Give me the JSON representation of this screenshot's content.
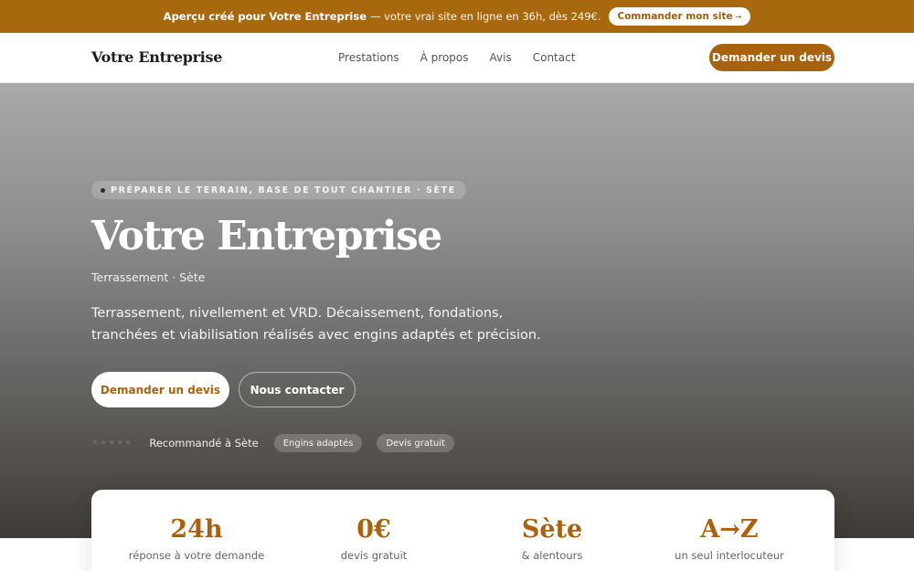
{
  "banner": {
    "strong_text": "Aperçu créé pour Votre Entreprise",
    "rest_text": "— votre vrai site en ligne en 36h, dès 249€.",
    "button_label": "Commander mon site",
    "button_arrow": "→"
  },
  "nav": {
    "brand": "Votre Entreprise",
    "items": [
      {
        "label": "Prestations"
      },
      {
        "label": "À propos"
      },
      {
        "label": "Avis"
      },
      {
        "label": "Contact"
      }
    ],
    "cta_label": "Demander un devis"
  },
  "hero": {
    "eyebrow": "PRÉPARER LE TERRAIN, BASE DE TOUT CHANTIER · SÈTE",
    "title": "Votre Entreprise",
    "subtitle": "Terrassement · Sète",
    "description": "Terrassement, nivellement et VRD. Décaissement, fondations, tranchées et viabilisation réalisés avec engins adaptés et précision.",
    "primary_button": "Demander un devis",
    "secondary_button": "Nous contacter",
    "stars": "★★★★★",
    "trust_text": "Recommandé à Sète",
    "chips": [
      "Engins adaptés",
      "Devis gratuit"
    ]
  },
  "stats": [
    {
      "value": "24h",
      "label": "réponse à votre demande"
    },
    {
      "value": "0€",
      "label": "devis gratuit"
    },
    {
      "value": "Sète",
      "label": "& alentours"
    },
    {
      "value": "A→Z",
      "label": "un seul interlocuteur"
    }
  ],
  "colors": {
    "accent": "#a8620c",
    "banner": "#a8680e",
    "white": "#ffffff"
  }
}
